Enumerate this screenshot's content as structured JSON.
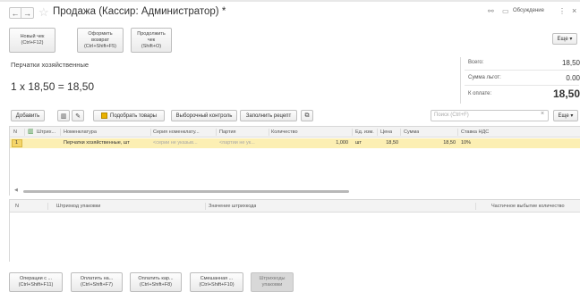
{
  "window": {
    "title": "Продажа (Кассир: Администратор) *",
    "discussion": "Обсуждение",
    "more_top": "⋮",
    "close": "×"
  },
  "commands": {
    "new_check": [
      "Новый чек",
      "(Ctrl+F12)"
    ],
    "return": [
      "Оформить",
      "возврат",
      "(Ctrl+Shift+F5)"
    ],
    "continue": [
      "Продолжить",
      "чек",
      "(Shift+O)"
    ],
    "more": "Еще ▾"
  },
  "item": {
    "name": "Перчатки хозяйственные",
    "calc": "1 x 18,50 = 18,50"
  },
  "totals": {
    "total_label": "Всего:",
    "total_value": "18,50",
    "discount_label": "Сумма льгот:",
    "discount_value": "0.00",
    "pay_label": "К оплате:",
    "pay_value": "18,50"
  },
  "toolbar": {
    "add": "Добавить",
    "pick": "Подобрать товары",
    "selective": "Выборочный контроль",
    "recipe": "Заполнить рецепт",
    "search_placeholder": "Поиск (Ctrl+F)",
    "search_clear": "×",
    "more": "Еще ▾"
  },
  "table": {
    "headers": [
      "N",
      "Штрих...",
      "Номенклатура",
      "Серия номенклату...",
      "Партия",
      "Количество",
      "Ед. изм.",
      "Цена",
      "Сумма",
      "Ставка НДС"
    ],
    "rows": [
      {
        "n": "1",
        "barcode": "",
        "name": "Перчатки хозяйственные, шт",
        "series": "<серии не указыв...",
        "batch": "<партии не ук...",
        "qty": "1,000",
        "unit": "шт",
        "price": "18,50",
        "sum": "18,50",
        "vat": "10%"
      }
    ]
  },
  "table2": {
    "headers": [
      "N",
      "Штрихкод упаковки",
      "Значение штрихкода",
      "Частичное выбытие количество"
    ]
  },
  "bottom": {
    "operations": [
      "Операции с ...",
      "(Ctrl+Shift+F11)"
    ],
    "pay_card": [
      "Оплатить на...",
      "(Ctrl+Shift+F7)"
    ],
    "pay_card2": [
      "Оплатить кар...",
      "(Ctrl+Shift+F8)"
    ],
    "mixed": [
      "Смешанная ...",
      "(Ctrl+Shift+F10)"
    ],
    "barcodes": [
      "Штрихкоды",
      "упаковки"
    ]
  },
  "colors": {
    "selected_row": "#fcefb3",
    "star": "#c9c9c9",
    "accent_green": "#3a8e3a",
    "pick_yellow": "#e9b100"
  }
}
